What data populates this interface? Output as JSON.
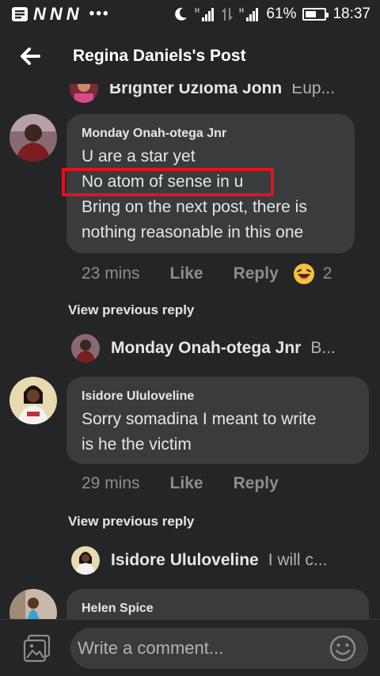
{
  "status_bar": {
    "network_letters": [
      "N",
      "N",
      "N"
    ],
    "dots": "•••",
    "battery": "61%",
    "battery_level": 0.61,
    "time": "18:37"
  },
  "header": {
    "title": "Regina Daniels's Post"
  },
  "thread": {
    "top_reply": {
      "name": "Brighter Uzioma John",
      "snippet": "Eup..."
    },
    "comment1": {
      "author": "Monday Onah-otega Jnr",
      "lines": [
        "U are a star yet",
        "No atom of sense in u",
        "Bring on the next post, there is",
        "nothing reasonable in this one"
      ],
      "time": "23 mins",
      "like": "Like",
      "reply": "Reply",
      "reaction_count": "2"
    },
    "view_previous_1": "View previous reply",
    "reply1": {
      "name": "Monday Onah-otega Jnr",
      "snippet": "B..."
    },
    "comment2": {
      "author": "Isidore Ululoveline",
      "lines": [
        "Sorry somadina I meant to write",
        "is he the victim"
      ],
      "time": "29 mins",
      "like": "Like",
      "reply": "Reply"
    },
    "view_previous_2": "View previous reply",
    "reply2": {
      "name": "Isidore Ululoveline",
      "snippet": "I will c..."
    },
    "comment3": {
      "author": "Helen Spice"
    }
  },
  "composer": {
    "placeholder": "Write a comment..."
  },
  "colors": {
    "background": "#242526",
    "bubble": "#3a3b3c",
    "highlight": "#e0141e",
    "muted": "#8a8d91"
  }
}
